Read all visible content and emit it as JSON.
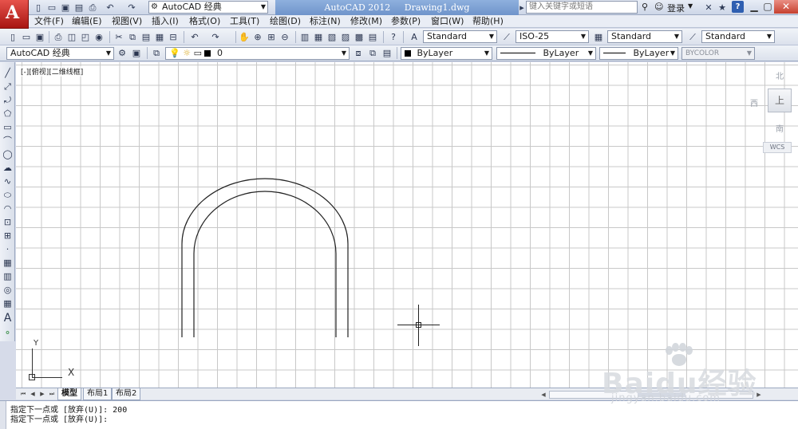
{
  "title_bar": {
    "app_logo": "A",
    "workspace": "AutoCAD 经典",
    "app_title": "AutoCAD 2012",
    "file_name": "Drawing1.dwg",
    "search_placeholder": "键入关键字或短语",
    "login_label": "登录",
    "help_label": "?"
  },
  "menu": [
    {
      "label": "文件(F)"
    },
    {
      "label": "编辑(E)"
    },
    {
      "label": "视图(V)"
    },
    {
      "label": "插入(I)"
    },
    {
      "label": "格式(O)"
    },
    {
      "label": "工具(T)"
    },
    {
      "label": "绘图(D)"
    },
    {
      "label": "标注(N)"
    },
    {
      "label": "修改(M)"
    },
    {
      "label": "参数(P)"
    },
    {
      "label": "窗口(W)"
    },
    {
      "label": "帮助(H)"
    }
  ],
  "styles_toolbar": {
    "text_style": "Standard",
    "dim_style": "ISO-25",
    "table_style": "Standard",
    "multileader_style": "Standard"
  },
  "layers_toolbar": {
    "workspace": "AutoCAD 经典",
    "current_layer": "0",
    "color": "ByLayer",
    "linetype": "ByLayer",
    "lineweight": "ByLayer",
    "plotstyle": "BYCOLOR"
  },
  "viewport": {
    "label": "[-][俯视][二维线框]"
  },
  "viewcube": {
    "north": "北",
    "west": "西",
    "south": "南",
    "top": "上",
    "wcs": "WCS"
  },
  "ucs": {
    "x": "X",
    "y": "Y"
  },
  "layout_tabs": [
    {
      "label": "模型",
      "active": true
    },
    {
      "label": "布局1",
      "active": false
    },
    {
      "label": "布局2",
      "active": false
    }
  ],
  "command_lines": [
    "指定下一点或 [放弃(U)]: 200",
    "指定下一点或 [放弃(U)]:"
  ],
  "watermark": {
    "brand": "Bai",
    "brand_du": "du",
    "brand_cn": "经验",
    "url": "jingyan.baidu.com"
  },
  "colors": {
    "title_active": "#7a9fd6",
    "logo_red": "#c2201b",
    "grid": "#c8c8c8"
  }
}
